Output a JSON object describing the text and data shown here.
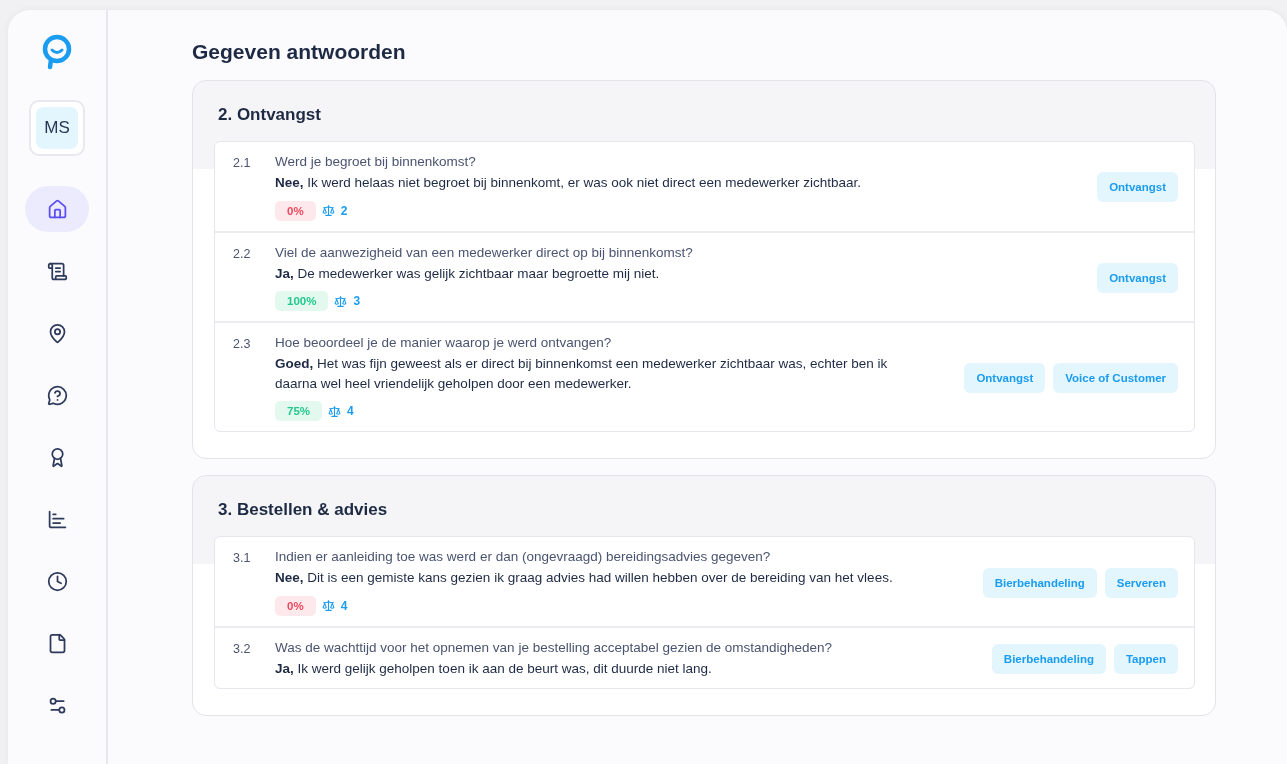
{
  "user": {
    "initials": "MS"
  },
  "nav": [
    {
      "kind": "home",
      "selected": true
    },
    {
      "kind": "scroll",
      "selected": false
    },
    {
      "kind": "pin",
      "selected": false
    },
    {
      "kind": "question",
      "selected": false
    },
    {
      "kind": "award",
      "selected": false
    },
    {
      "kind": "chart",
      "selected": false
    },
    {
      "kind": "clock",
      "selected": false
    },
    {
      "kind": "file",
      "selected": false
    },
    {
      "kind": "sliders",
      "selected": false
    }
  ],
  "title": "Gegeven antwoorden",
  "sections": [
    {
      "title": "2. Ontvangst",
      "questions": [
        {
          "number": "2.1",
          "question": "Werd je begroet bij binnenkomst?",
          "answer": "**Nee,** Ik werd helaas niet begroet bij binnenkomt, er was ook niet direct een medewerker zichtbaar.",
          "score": {
            "text": "0%",
            "kind": "low"
          },
          "weight": "2",
          "tags": [
            "Ontvangst"
          ]
        },
        {
          "number": "2.2",
          "question": "Viel de aanwezigheid van een medewerker direct op bij binnenkomst?",
          "answer": "**Ja,** De medewerker was gelijk zichtbaar maar begroette mij niet.",
          "score": {
            "text": "100%",
            "kind": "high"
          },
          "weight": "3",
          "tags": [
            "Ontvangst"
          ]
        },
        {
          "number": "2.3",
          "question": "Hoe beoordeel je de manier waarop je werd ontvangen?",
          "answer": "**Goed,** Het was fijn geweest als er direct bij binnenkomst een medewerker zichtbaar was, echter ben ik daarna wel heel vriendelijk geholpen door een medewerker.",
          "score": {
            "text": "75%",
            "kind": "high"
          },
          "weight": "4",
          "tags": [
            "Ontvangst",
            "Voice of Customer"
          ]
        }
      ]
    },
    {
      "title": "3. Bestellen & advies",
      "questions": [
        {
          "number": "3.1",
          "question": "Indien er aanleiding toe was werd er dan (ongevraagd) bereidingsadvies gegeven?",
          "answer": "**Nee,** Dit is een gemiste kans gezien ik graag advies had willen hebben over de bereiding van het vlees.",
          "score": {
            "text": "0%",
            "kind": "low"
          },
          "weight": "4",
          "tags": [
            "Bierbehandeling",
            "Serveren"
          ]
        },
        {
          "number": "3.2",
          "question": "Was de wachttijd voor het opnemen van je bestelling acceptabel gezien de omstandigheden?",
          "answer": "**Ja,** Ik werd gelijk geholpen toen ik aan de beurt was, dit duurde niet lang.",
          "tags": [
            "Bierbehandeling",
            "Tappen"
          ]
        }
      ]
    }
  ]
}
